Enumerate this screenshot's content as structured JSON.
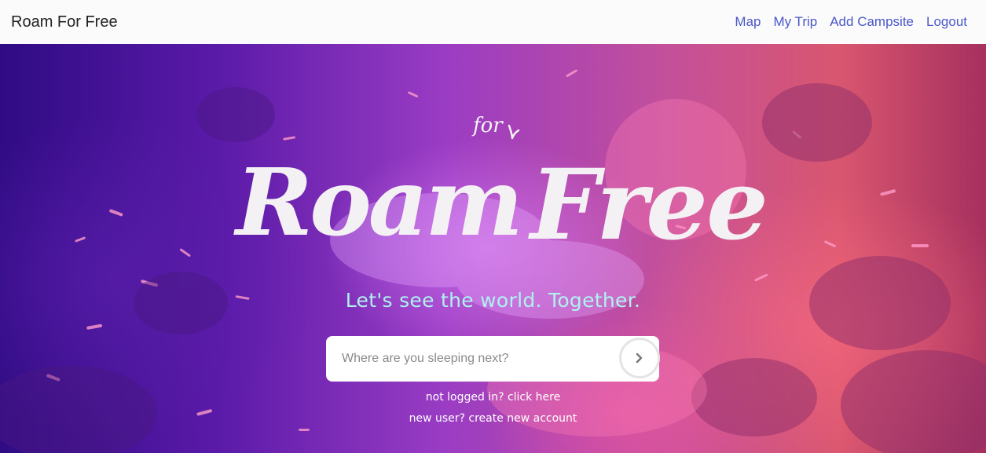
{
  "navbar": {
    "brand": "Roam For Free",
    "links": [
      {
        "label": "Map"
      },
      {
        "label": "My Trip"
      },
      {
        "label": "Add Campsite"
      },
      {
        "label": "Logout"
      }
    ]
  },
  "hero": {
    "title_small": "for",
    "title_main_1": "Roam",
    "title_main_2": "Free",
    "tagline": "Let's see the world. Together.",
    "search": {
      "placeholder": "Where are you sleeping next?",
      "value": ""
    },
    "login_link": "not logged in? click here",
    "signup_link": "new user? create new account"
  },
  "colors": {
    "nav_link": "#4a57c9",
    "tagline": "#aef3f0",
    "hero_left": "#2f0b84",
    "hero_right": "#d9566f"
  },
  "icons": {
    "search_submit": "chevron-right-icon"
  }
}
